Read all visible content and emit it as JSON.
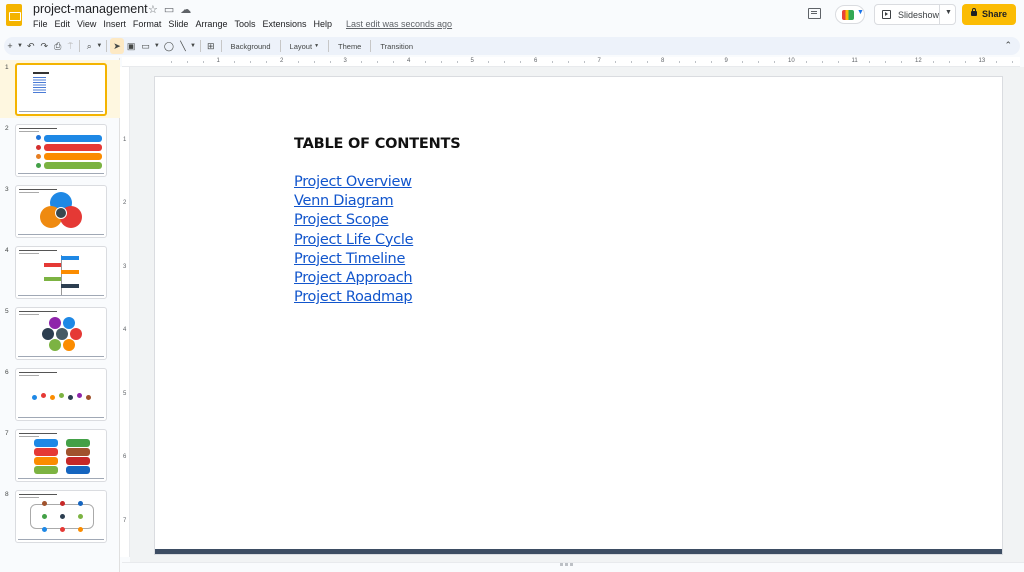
{
  "app": {
    "doc_title": "project-management",
    "title_icons": [
      "star-icon",
      "folder-icon",
      "cloud-icon"
    ],
    "menu": [
      "File",
      "Edit",
      "View",
      "Insert",
      "Format",
      "Slide",
      "Arrange",
      "Tools",
      "Extensions",
      "Help"
    ],
    "last_edit": "Last edit was seconds ago",
    "slideshow_label": "Slideshow",
    "share_label": "Share",
    "accent_color": "#fbbc04"
  },
  "toolbar": {
    "background_label": "Background",
    "layout_label": "Layout",
    "theme_label": "Theme",
    "transition_label": "Transition"
  },
  "ruler": {
    "horizontal": [
      "1",
      "2",
      "3",
      "4",
      "5",
      "6",
      "7",
      "8",
      "9",
      "10",
      "11",
      "12",
      "13"
    ],
    "vertical": [
      "1",
      "2",
      "3",
      "4",
      "5",
      "6",
      "7"
    ]
  },
  "filmstrip": {
    "selected": 1,
    "slides": [
      {
        "number": "1",
        "kind": "table-of-contents"
      },
      {
        "number": "2",
        "kind": "stacked-bars"
      },
      {
        "number": "3",
        "kind": "venn"
      },
      {
        "number": "4",
        "kind": "timeline-steps"
      },
      {
        "number": "5",
        "kind": "hexagon-cycle"
      },
      {
        "number": "6",
        "kind": "timeline-dots"
      },
      {
        "number": "7",
        "kind": "two-column-blocks"
      },
      {
        "number": "8",
        "kind": "roadmap"
      }
    ]
  },
  "slide": {
    "title": "TABLE OF CONTENTS",
    "links": [
      "Project Overview",
      "Venn Diagram",
      "Project Scope",
      "Project Life Cycle",
      "Project Timeline",
      "Project Approach",
      "Project Roadmap"
    ],
    "link_color": "#1155cc",
    "footer_color": "#3d4d63"
  }
}
